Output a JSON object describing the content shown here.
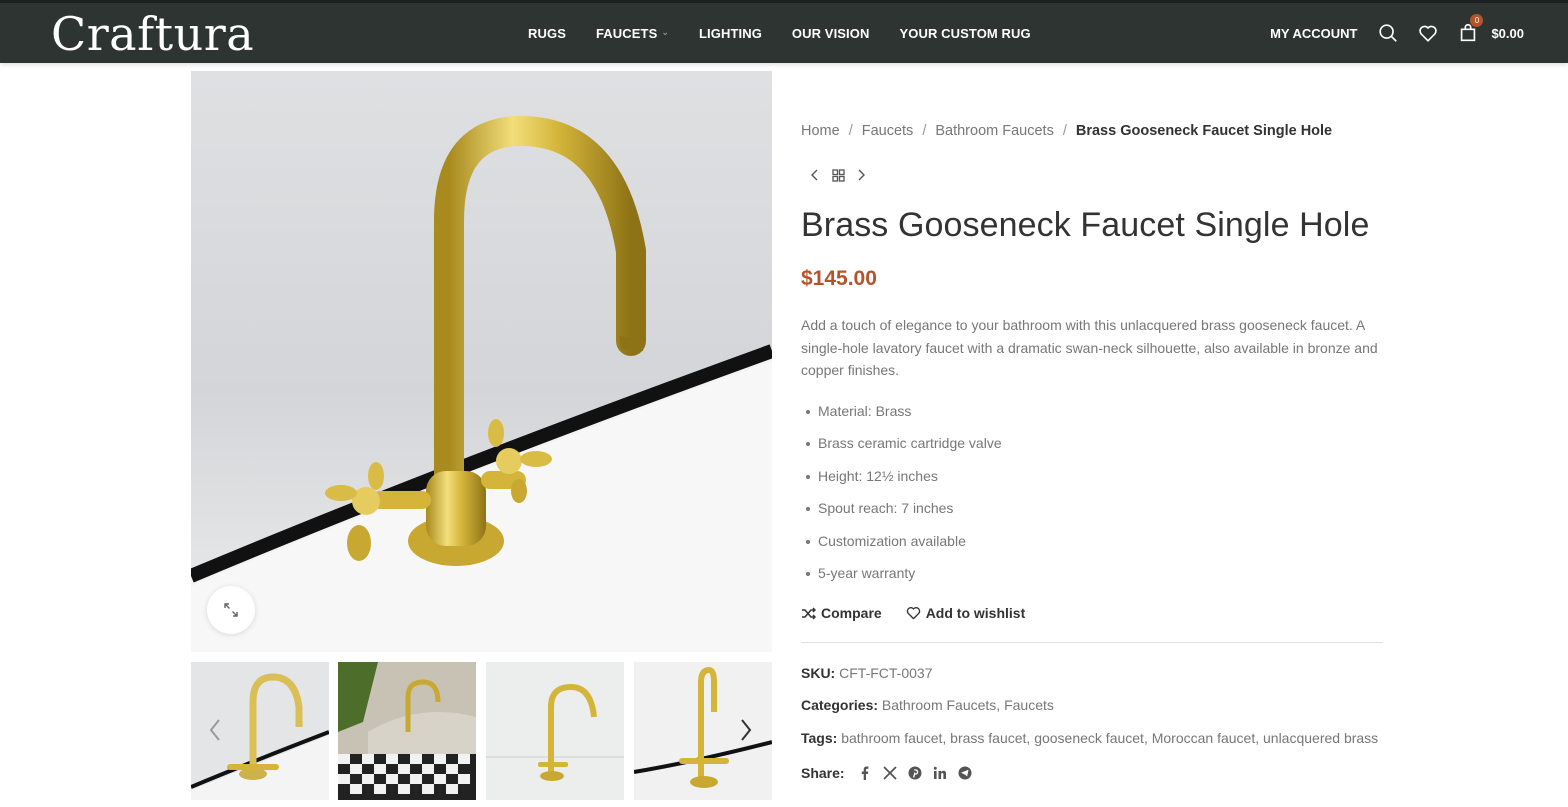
{
  "header": {
    "logo": "Craftura",
    "nav": [
      {
        "label": "RUGS",
        "has_dropdown": false
      },
      {
        "label": "FAUCETS",
        "has_dropdown": true
      },
      {
        "label": "LIGHTING",
        "has_dropdown": false
      },
      {
        "label": "OUR VISION",
        "has_dropdown": false
      },
      {
        "label": "YOUR CUSTOM RUG",
        "has_dropdown": false
      }
    ],
    "account_label": "MY ACCOUNT",
    "icons": [
      "search-icon",
      "heart-icon",
      "cart-icon"
    ],
    "cart_count": "0",
    "cart_total": "$0.00"
  },
  "breadcrumb": {
    "items": [
      "Home",
      "Faucets",
      "Bathroom Faucets"
    ],
    "current": "Brass Gooseneck Faucet Single Hole"
  },
  "product": {
    "title": "Brass Gooseneck Faucet Single Hole",
    "price": "$145.00",
    "description": "Add a touch of elegance to your bathroom with this unlacquered brass gooseneck faucet. A single-hole lavatory faucet with a dramatic swan-neck silhouette, also available in bronze and copper finishes.",
    "features": [
      "Material: Brass",
      "Brass ceramic cartridge valve",
      "Height: 12½ inches",
      "Spout reach: 7 inches",
      "Customization available",
      "5-year warranty"
    ],
    "compare_label": "Compare",
    "wishlist_label": "Add to wishlist",
    "sku_label": "SKU:",
    "sku": "CFT-FCT-0037",
    "categories_label": "Categories:",
    "categories": "Bathroom Faucets, Faucets",
    "tags_label": "Tags:",
    "tags": "bathroom faucet, brass faucet, gooseneck faucet, Moroccan faucet, unlacquered brass",
    "share_label": "Share:",
    "share_icons": [
      "facebook-icon",
      "x-icon",
      "pinterest-icon",
      "linkedin-icon",
      "telegram-icon"
    ]
  },
  "colors": {
    "header_bg": "#2e3432",
    "accent": "#b5542c",
    "brass": "#d4b53a"
  }
}
